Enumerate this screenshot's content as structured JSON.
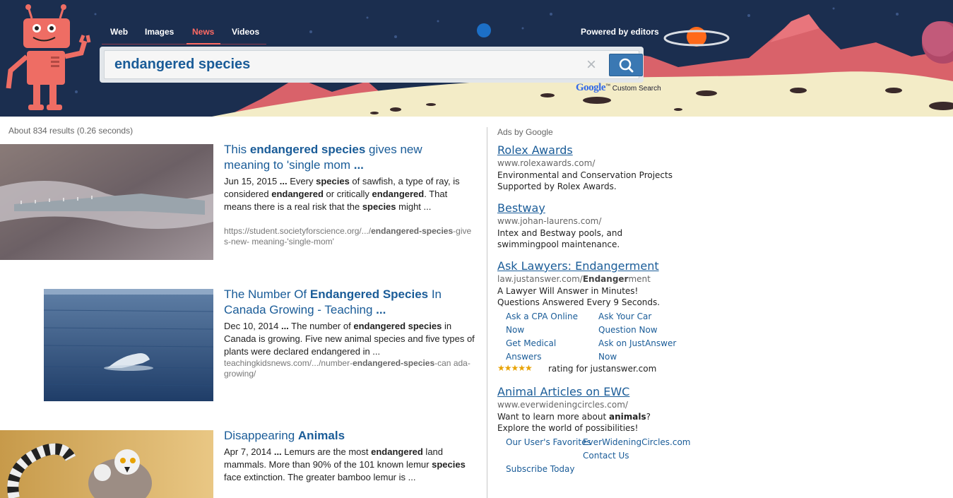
{
  "nav": {
    "items": [
      "Web",
      "Images",
      "News",
      "Videos"
    ],
    "active": "News"
  },
  "header": {
    "powered_by": "Powered by editors"
  },
  "search": {
    "query": "endangered species",
    "clear_symbol": "×",
    "google_logo": "Google",
    "google_tm": "™",
    "custom_search": "Custom Search"
  },
  "stats": "About 834 results (0.26 seconds)",
  "results": [
    {
      "title_parts": [
        {
          "t": "This ",
          "b": false
        },
        {
          "t": "endangered species",
          "b": true
        },
        {
          "t": " gives new meaning to 'single mom ",
          "b": false
        },
        {
          "t": "...",
          "b": true
        }
      ],
      "snippet_parts": [
        {
          "t": "Jun 15, 2015 ",
          "b": false
        },
        {
          "t": "...",
          "b": true
        },
        {
          "t": " Every ",
          "b": false
        },
        {
          "t": "species",
          "b": true
        },
        {
          "t": " of sawfish, a type of ray, is considered ",
          "b": false
        },
        {
          "t": "endangered",
          "b": true
        },
        {
          "t": " or critically ",
          "b": false
        },
        {
          "t": "endangered",
          "b": true
        },
        {
          "t": ". That means there is a real risk that the ",
          "b": false
        },
        {
          "t": "species",
          "b": true
        },
        {
          "t": " might ...",
          "b": false
        }
      ],
      "url_parts": [
        {
          "t": "https://student.societyforscience.org/.../",
          "b": false
        },
        {
          "t": "endangered-specie",
          "b": true
        },
        {
          "t": "s",
          "b": true
        },
        {
          "t": "-gives-new- meaning-'single-mom'",
          "b": false
        }
      ]
    },
    {
      "title_parts": [
        {
          "t": "The Number Of ",
          "b": false
        },
        {
          "t": "Endangered Species",
          "b": true
        },
        {
          "t": " In Canada Growing - Teaching ",
          "b": false
        },
        {
          "t": "...",
          "b": true
        }
      ],
      "snippet_parts": [
        {
          "t": "Dec 10, 2014 ",
          "b": false
        },
        {
          "t": "...",
          "b": true
        },
        {
          "t": " The number of ",
          "b": false
        },
        {
          "t": "endangered species",
          "b": true
        },
        {
          "t": " in Canada is growing. Five new animal species and five types of plants were declared endangered in ...",
          "b": false
        }
      ],
      "url_parts": [
        {
          "t": "teachingkidsnews.com/.../number-",
          "b": false
        },
        {
          "t": "endangered-species",
          "b": true
        },
        {
          "t": "-can ada-growing/",
          "b": false
        }
      ]
    },
    {
      "title_parts": [
        {
          "t": "Disappearing ",
          "b": false
        },
        {
          "t": "Animals",
          "b": true
        }
      ],
      "snippet_parts": [
        {
          "t": "Apr 7, 2014 ",
          "b": false
        },
        {
          "t": "...",
          "b": true
        },
        {
          "t": " Lemurs are the most ",
          "b": false
        },
        {
          "t": "endangered",
          "b": true
        },
        {
          "t": " land mammals. More than 90% of the 101 known lemur ",
          "b": false
        },
        {
          "t": "species",
          "b": true
        },
        {
          "t": " face extinction. The greater bamboo lemur is ...",
          "b": false
        }
      ],
      "url_parts": []
    }
  ],
  "ads": {
    "label": "Ads by Google",
    "items": [
      {
        "title": "Rolex Awards",
        "url": "www.rolexawards.com/",
        "desc": [
          "Environmental and Conservation Projects",
          "Supported by Rolex Awards."
        ]
      },
      {
        "title": "Bestway",
        "url": "www.johan-laurens.com/",
        "desc": [
          "Intex and Bestway pools, and",
          "swimmingpool maintenance."
        ]
      },
      {
        "title": "Ask Lawyers: Endangerment",
        "url_prefix": "law.justanswer.com/",
        "url_bold": "Endanger",
        "url_suffix": "ment",
        "desc": [
          "A Lawyer Will Answer in Minutes!",
          "Questions Answered Every 9 Seconds."
        ],
        "sitelinks": [
          "Ask a CPA Online Now",
          "Ask Your Car Question Now",
          "Get Medical Answers",
          "Ask on JustAnswer Now"
        ],
        "stars": "★★★★★",
        "rating_text": "rating for justanswer.com"
      },
      {
        "title": "Animal Articles on EWC",
        "url": "www.everwideningcircles.com/",
        "desc_l1_prefix": "Want to learn more about ",
        "desc_l1_bold": "animals",
        "desc_l1_suffix": "?",
        "desc_l2": "Explore the world of possibilities!",
        "sitelinks": [
          "Our User's Favorites",
          "EverWideningCircles.com",
          "Subscribe Today",
          "Contact Us"
        ]
      }
    ]
  },
  "colors": {
    "header_bg": "#1b2e4f",
    "accent_red": "#ff6a63",
    "link_blue": "#1a5c98",
    "search_button": "#3a78b3"
  }
}
